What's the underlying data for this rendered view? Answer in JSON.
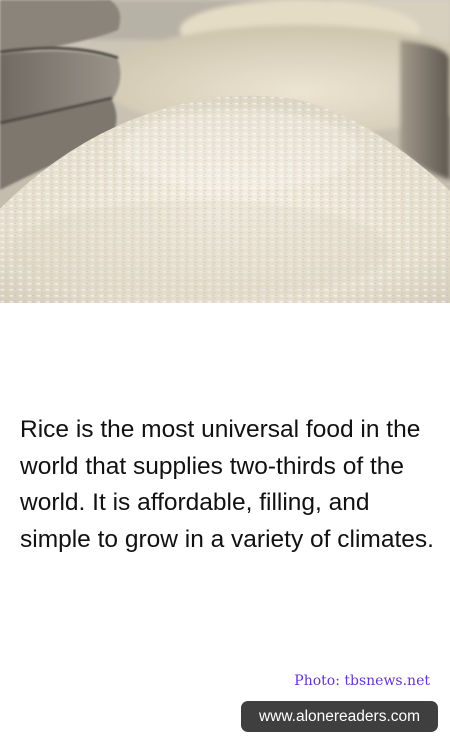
{
  "photo": {
    "subject": "rice-piles-photo"
  },
  "caption": {
    "text": "Rice is the most universal food in the world that supplies two-thirds of the world. It is affordable, filling, and simple to grow in a variety of climates."
  },
  "credit": {
    "text": "Photo: tbsnews.net"
  },
  "site": {
    "label": "www.alonereaders.com"
  },
  "colors": {
    "caption_text": "#111111",
    "credit_text": "#6633cc",
    "badge_background": "#3f3f3f",
    "badge_text": "#ffffff"
  }
}
